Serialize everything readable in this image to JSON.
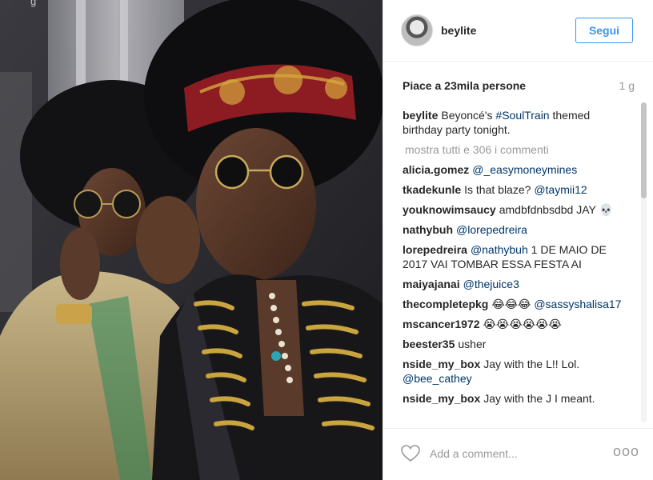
{
  "post": {
    "photo_corner_text": "g",
    "username": "beylite",
    "follow_label": "Segui",
    "likes": "Piace a 23mila persone",
    "age": "1 g",
    "caption": {
      "user": "beylite",
      "text_before": "Beyoncé's ",
      "hashtag": "#SoulTrain",
      "text_after": " themed birthday party tonight."
    },
    "show_all": "mostra tutti e 306 i commenti",
    "comments": [
      {
        "user": "alicia.gomez",
        "text": "",
        "tag": "@_easymoneymines"
      },
      {
        "user": "tkadekunle",
        "text": "Is that blaze? ",
        "tag": "@taymii12"
      },
      {
        "user": "youknowimsaucy",
        "text": "amdbfdnbsdbd JAY 💀",
        "tag": ""
      },
      {
        "user": "nathybuh",
        "text": "",
        "tag": "@lorepedreira"
      },
      {
        "user": "lorepedreira",
        "text": " 1 DE MAIO DE 2017 VAI TOMBAR ESSA FESTA AI",
        "tag": "@nathybuh",
        "tag_first": true
      },
      {
        "user": "maiyajanai",
        "text": "",
        "tag": "@thejuice3"
      },
      {
        "user": "thecompletepkg",
        "text": "😂😂😂 ",
        "tag": "@sassyshalisa17"
      },
      {
        "user": "mscancer1972",
        "text": "😭😭😭😭😭😭",
        "tag": ""
      },
      {
        "user": "beester35",
        "text": "usher",
        "tag": ""
      },
      {
        "user": "nside_my_box",
        "text": "Jay with the L!! Lol. ",
        "tag": "@bee_cathey"
      },
      {
        "user": "nside_my_box",
        "text": "Jay with the J I meant.",
        "tag": ""
      }
    ],
    "add_comment_placeholder": "Add a comment...",
    "more_icon_text": "ooo"
  },
  "colors": {
    "link": "#003569",
    "follow": "#3897f0",
    "muted": "#999999"
  }
}
